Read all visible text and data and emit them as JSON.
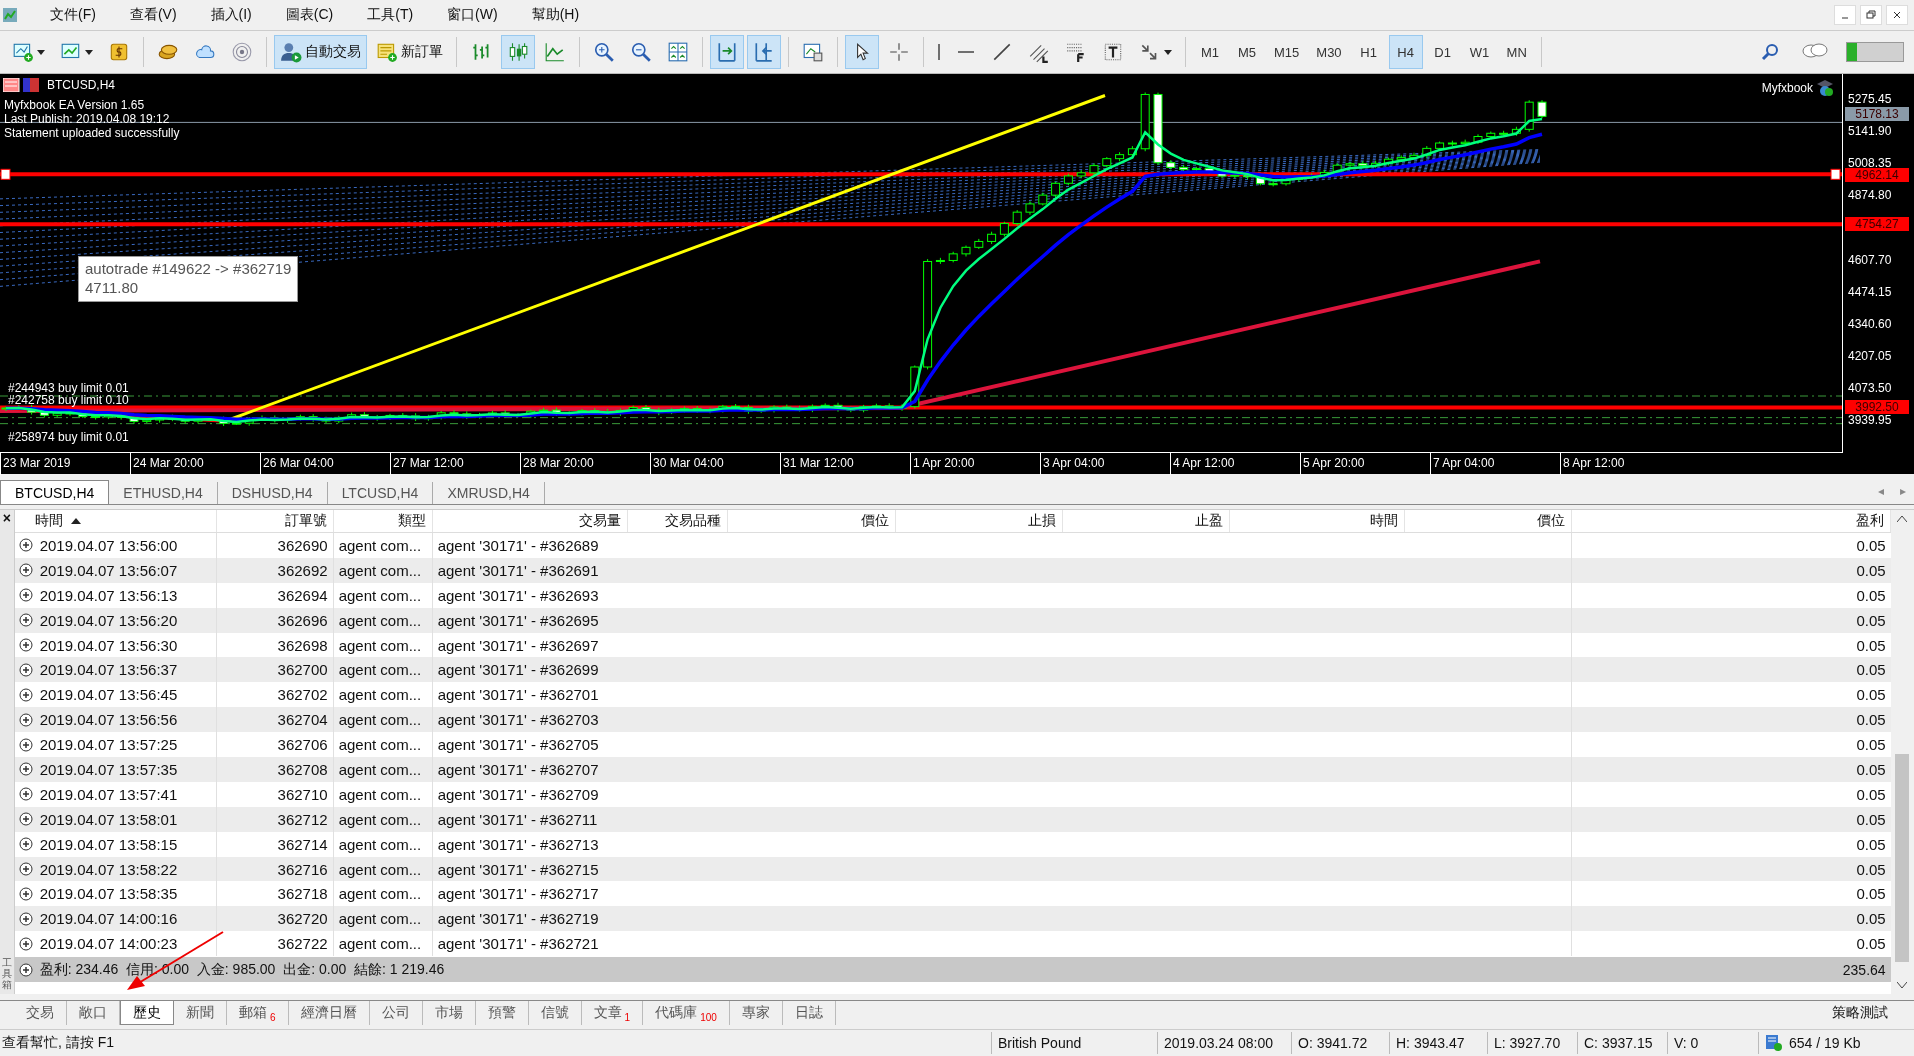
{
  "menu": {
    "items": [
      "文件(F)",
      "查看(V)",
      "插入(I)",
      "圖表(C)",
      "工具(T)",
      "窗口(W)",
      "幫助(H)"
    ]
  },
  "toolbar": {
    "items": [
      {
        "kind": "chart-add",
        "pressed": false,
        "dropdown": true
      },
      {
        "kind": "chart-window",
        "pressed": false,
        "dropdown": true
      },
      {
        "kind": "money",
        "pressed": false,
        "dropdown": false
      },
      {
        "kind": "separator"
      },
      {
        "kind": "coins",
        "pressed": false,
        "dropdown": false
      },
      {
        "kind": "cloud",
        "pressed": false,
        "dropdown": false
      },
      {
        "kind": "signal",
        "pressed": false,
        "dropdown": false
      },
      {
        "kind": "separator"
      },
      {
        "kind": "autotrade",
        "label": "自動交易",
        "pressed": true,
        "dropdown": false
      },
      {
        "kind": "order",
        "label": "新訂單",
        "pressed": false,
        "dropdown": false
      },
      {
        "kind": "separator"
      },
      {
        "kind": "bar-chart",
        "pressed": false,
        "dropdown": false
      },
      {
        "kind": "candles",
        "pressed": true,
        "dropdown": false
      },
      {
        "kind": "line-chart",
        "pressed": false,
        "dropdown": false
      },
      {
        "kind": "separator"
      },
      {
        "kind": "zoom-in",
        "pressed": false,
        "dropdown": false
      },
      {
        "kind": "zoom-out",
        "pressed": false,
        "dropdown": false
      },
      {
        "kind": "tile",
        "pressed": false,
        "dropdown": false
      },
      {
        "kind": "separator"
      },
      {
        "kind": "autoscroll",
        "pressed": true,
        "dropdown": false
      },
      {
        "kind": "shift",
        "pressed": true,
        "dropdown": false
      },
      {
        "kind": "separator"
      },
      {
        "kind": "template",
        "pressed": false,
        "dropdown": false
      },
      {
        "kind": "separator"
      },
      {
        "kind": "cursor",
        "pressed": true,
        "dropdown": false
      },
      {
        "kind": "crosshair",
        "pressed": false,
        "dropdown": false
      },
      {
        "kind": "separator"
      },
      {
        "kind": "vline",
        "pressed": false,
        "dropdown": false
      },
      {
        "kind": "hline",
        "pressed": false,
        "dropdown": false
      },
      {
        "kind": "trendline",
        "pressed": false,
        "dropdown": false
      },
      {
        "kind": "channels",
        "pressed": false,
        "dropdown": false
      },
      {
        "kind": "fibo",
        "pressed": false,
        "dropdown": false
      },
      {
        "kind": "text",
        "pressed": false,
        "dropdown": false
      },
      {
        "kind": "arrows",
        "pressed": false,
        "dropdown": true
      }
    ]
  },
  "timeframes": [
    {
      "label": "M1",
      "selected": false
    },
    {
      "label": "M5",
      "selected": false
    },
    {
      "label": "M15",
      "selected": false
    },
    {
      "label": "M30",
      "selected": false
    },
    {
      "label": "H1",
      "selected": false
    },
    {
      "label": "H4",
      "selected": true
    },
    {
      "label": "D1",
      "selected": false
    },
    {
      "label": "W1",
      "selected": false
    },
    {
      "label": "MN",
      "selected": false
    }
  ],
  "chart": {
    "title": "BTCUSD,H4",
    "info_lines": [
      "Myfxbook EA Version 1.65",
      "Last Publish: 2019.04.08 19:12",
      "Statement uploaded successfully"
    ],
    "badge": "Myfxbook",
    "tooltip": {
      "line_1": "autotrade #149622 -> #362719",
      "line_2": "4711.80"
    },
    "order_labels": [
      "#244943 buy limit 0.01",
      "#242758 buy limit 0.10",
      "#258974 buy limit 0.01"
    ],
    "price_ticks": [
      "5275.45",
      "5141.90",
      "5008.35",
      "4874.80",
      "4607.70",
      "4474.15",
      "4340.60",
      "4207.05",
      "4073.50",
      "3939.95"
    ],
    "price_levels": [
      {
        "value": "5178.13",
        "color": "#8a9aa8"
      },
      {
        "value": "4962.14",
        "color": "#ff0000"
      },
      {
        "value": "4754.27",
        "color": "#ff0000"
      },
      {
        "value": "3992.50",
        "color": "#ff0000"
      }
    ],
    "date_labels": [
      "23 Mar 2019",
      "24 Mar 20:00",
      "26 Mar 04:00",
      "27 Mar 12:00",
      "28 Mar 20:00",
      "30 Mar 04:00",
      "31 Mar 12:00",
      "1 Apr 20:00",
      "3 Apr 04:00",
      "4 Apr 12:00",
      "5 Apr 20:00",
      "7 Apr 04:00",
      "8 Apr 12:00"
    ]
  },
  "symbol_tabs": [
    {
      "label": "BTCUSD,H4",
      "selected": true
    },
    {
      "label": "ETHUSD,H4",
      "selected": false
    },
    {
      "label": "DSHUSD,H4",
      "selected": false
    },
    {
      "label": "LTCUSD,H4",
      "selected": false
    },
    {
      "label": "XMRUSD,H4",
      "selected": false
    }
  ],
  "tab_scroll": [
    "◂",
    "▸"
  ],
  "close_glyph": "×",
  "toolbox_label": "工具箱",
  "history": {
    "columns": [
      {
        "label": "時間",
        "sorted": true
      },
      {
        "label": "訂單號",
        "sorted": false
      },
      {
        "label": "類型",
        "sorted": false
      },
      {
        "label": "交易量",
        "sorted": false
      },
      {
        "label": "交易品種",
        "sorted": false
      },
      {
        "label": "價位",
        "sorted": false
      },
      {
        "label": "止損",
        "sorted": false
      },
      {
        "label": "止盈",
        "sorted": false
      },
      {
        "label": "時間",
        "sorted": false
      },
      {
        "label": "價位",
        "sorted": false
      },
      {
        "label": "盈利",
        "sorted": false
      }
    ],
    "rows": [
      {
        "time": "2019.04.07 13:56:00",
        "order": "362690",
        "type": "agent com...",
        "comment": "agent '30171' - #362689",
        "profit": "0.05"
      },
      {
        "time": "2019.04.07 13:56:07",
        "order": "362692",
        "type": "agent com...",
        "comment": "agent '30171' - #362691",
        "profit": "0.05"
      },
      {
        "time": "2019.04.07 13:56:13",
        "order": "362694",
        "type": "agent com...",
        "comment": "agent '30171' - #362693",
        "profit": "0.05"
      },
      {
        "time": "2019.04.07 13:56:20",
        "order": "362696",
        "type": "agent com...",
        "comment": "agent '30171' - #362695",
        "profit": "0.05"
      },
      {
        "time": "2019.04.07 13:56:30",
        "order": "362698",
        "type": "agent com...",
        "comment": "agent '30171' - #362697",
        "profit": "0.05"
      },
      {
        "time": "2019.04.07 13:56:37",
        "order": "362700",
        "type": "agent com...",
        "comment": "agent '30171' - #362699",
        "profit": "0.05"
      },
      {
        "time": "2019.04.07 13:56:45",
        "order": "362702",
        "type": "agent com...",
        "comment": "agent '30171' - #362701",
        "profit": "0.05"
      },
      {
        "time": "2019.04.07 13:56:56",
        "order": "362704",
        "type": "agent com...",
        "comment": "agent '30171' - #362703",
        "profit": "0.05"
      },
      {
        "time": "2019.04.07 13:57:25",
        "order": "362706",
        "type": "agent com...",
        "comment": "agent '30171' - #362705",
        "profit": "0.05"
      },
      {
        "time": "2019.04.07 13:57:35",
        "order": "362708",
        "type": "agent com...",
        "comment": "agent '30171' - #362707",
        "profit": "0.05"
      },
      {
        "time": "2019.04.07 13:57:41",
        "order": "362710",
        "type": "agent com...",
        "comment": "agent '30171' - #362709",
        "profit": "0.05"
      },
      {
        "time": "2019.04.07 13:58:01",
        "order": "362712",
        "type": "agent com...",
        "comment": "agent '30171' - #362711",
        "profit": "0.05"
      },
      {
        "time": "2019.04.07 13:58:15",
        "order": "362714",
        "type": "agent com...",
        "comment": "agent '30171' - #362713",
        "profit": "0.05"
      },
      {
        "time": "2019.04.07 13:58:22",
        "order": "362716",
        "type": "agent com...",
        "comment": "agent '30171' - #362715",
        "profit": "0.05"
      },
      {
        "time": "2019.04.07 13:58:35",
        "order": "362718",
        "type": "agent com...",
        "comment": "agent '30171' - #362717",
        "profit": "0.05"
      },
      {
        "time": "2019.04.07 14:00:16",
        "order": "362720",
        "type": "agent com...",
        "comment": "agent '30171' - #362719",
        "profit": "0.05"
      },
      {
        "time": "2019.04.07 14:00:23",
        "order": "362722",
        "type": "agent com...",
        "comment": "agent '30171' - #362721",
        "profit": "0.05"
      }
    ],
    "summary": {
      "text": "盈利: 234.46  信用: 0.00  入金: 985.00  出金: 0.00  結餘: 1 219.46",
      "total": "235.64"
    }
  },
  "bottom_tabs": [
    {
      "label": "交易",
      "selected": false
    },
    {
      "label": "敞口",
      "selected": false
    },
    {
      "label": "歷史",
      "selected": true
    },
    {
      "label": "新聞",
      "selected": false
    },
    {
      "label": "郵箱",
      "badge": "6",
      "selected": false
    },
    {
      "label": "經濟日曆",
      "selected": false
    },
    {
      "label": "公司",
      "selected": false
    },
    {
      "label": "市場",
      "selected": false
    },
    {
      "label": "預警",
      "selected": false
    },
    {
      "label": "信號",
      "selected": false
    },
    {
      "label": "文章",
      "badge": "1",
      "selected": false
    },
    {
      "label": "代碼庫",
      "badge": "100",
      "selected": false
    },
    {
      "label": "專家",
      "selected": false
    },
    {
      "label": "日誌",
      "selected": false
    }
  ],
  "tester_tab": "策略測試",
  "status_bar": {
    "help": "查看幫忙, 請按 F1",
    "cells": [
      "British Pound",
      "2019.03.24 08:00",
      "O: 3941.72",
      "H: 3943.47",
      "L: 3927.70",
      "C: 3937.15",
      "V: 0"
    ],
    "traffic": "654 / 19 Kb"
  }
}
